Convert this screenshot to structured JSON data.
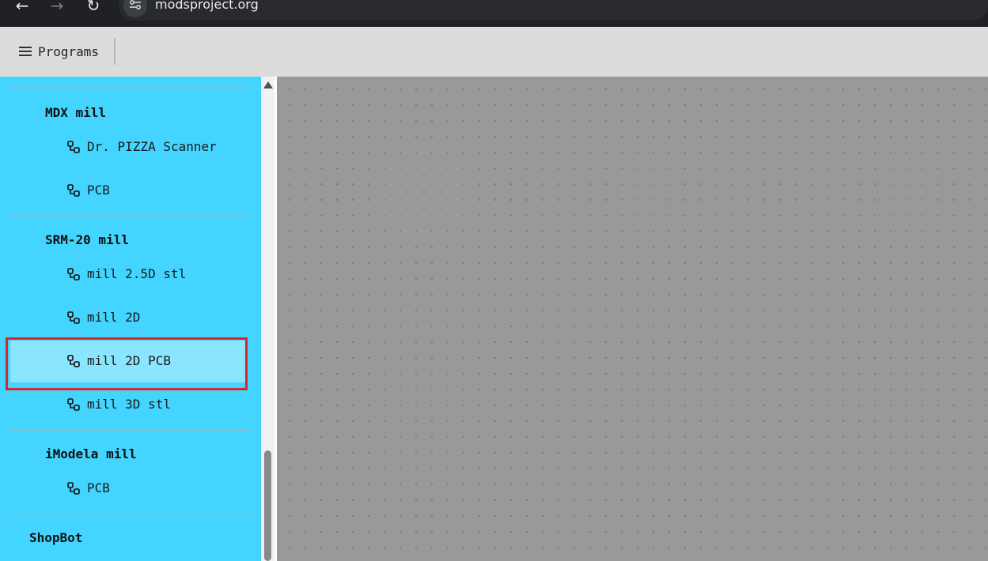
{
  "browser": {
    "url": "modsproject.org",
    "back_icon": "arrow-left-icon",
    "forward_icon": "arrow-right-icon",
    "reload_icon": "reload-icon"
  },
  "header": {
    "programs_label": "Programs",
    "menu_icon": "hamburger-icon"
  },
  "sidebar": {
    "groups": [
      {
        "title": "MDX mill",
        "items": [
          "Dr. PIZZA Scanner",
          "PCB"
        ]
      },
      {
        "title": "SRM-20 mill",
        "items": [
          "mill 2.5D stl",
          "mill 2D",
          "mill 2D PCB",
          "mill 3D stl"
        ]
      },
      {
        "title": "iModela mill",
        "items": [
          "PCB"
        ]
      },
      {
        "title": "ShopBot",
        "items": []
      }
    ],
    "selected_item": "mill 2D PCB",
    "item_icon": "program-link-icon"
  },
  "colors": {
    "sidebar_bg": "#43d5ff",
    "selected_bg": "#8ae6ff",
    "selection_outline": "#d9262c",
    "canvas_bg": "#999999",
    "header_bg": "#dcdcdc"
  }
}
